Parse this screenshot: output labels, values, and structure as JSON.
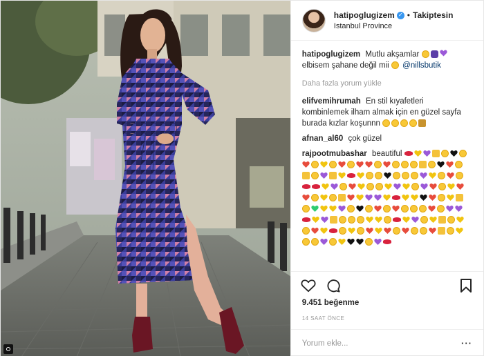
{
  "post": {
    "username": "hatipoglugizem",
    "separator": "•",
    "follow_status": "Takiptesin",
    "location": "Istanbul Province"
  },
  "caption": {
    "user": "hatipoglugizem",
    "text_1": "Mutlu akşamlar",
    "text_2": "elbisem şahane değil mii",
    "mention": "@nillsbutik"
  },
  "load_more": "Daha fazla yorum yükle",
  "comments": [
    {
      "user": "elifvemihrumah",
      "text": "En stil kıyafetleri kombinlemek ilham almak için en güzel sayfa burada kızlar koşunnn"
    },
    {
      "user": "afnan_al60",
      "text": "çok güzel"
    },
    {
      "user": "rajpootmubashar",
      "text": "beautiful"
    }
  ],
  "likes_text": "9.451 beğenme",
  "time_text": "14 SAAT ÖNCE",
  "add_comment_placeholder": "Yorum ekle...",
  "icons": {
    "like": "heart-outline-icon",
    "comment": "speech-bubble-icon",
    "save": "bookmark-icon",
    "verified": "verified-badge-icon",
    "more": "more-options-icon"
  },
  "colors": {
    "dress_blue": "#3f3f9c",
    "dress_pink": "#c06a9a",
    "boots": "#6a1624",
    "link": "#003569",
    "verified": "#3897f0"
  }
}
